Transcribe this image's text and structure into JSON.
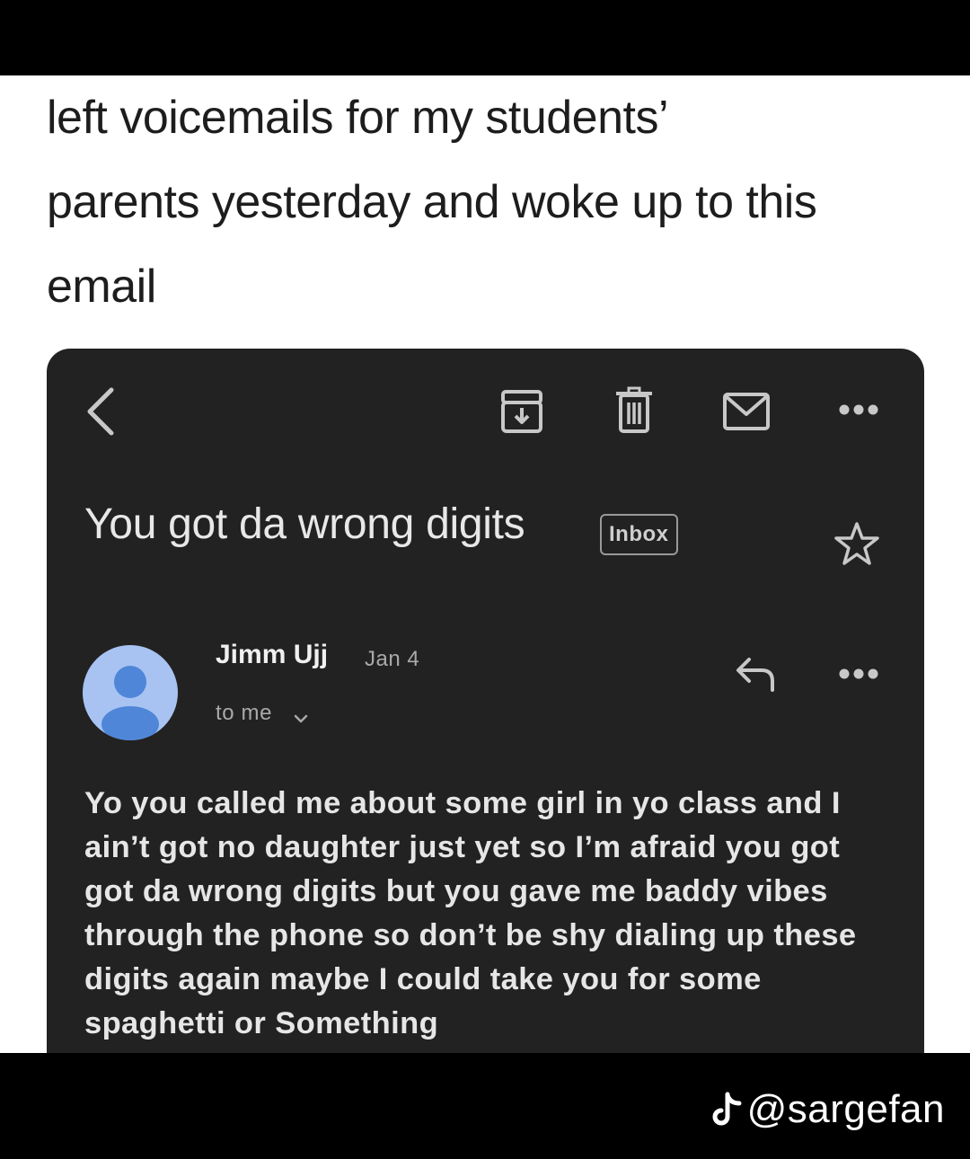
{
  "caption": {
    "line1": "left voicemails for my students’",
    "line2": "parents yesterday and woke up to this",
    "line3": "email"
  },
  "email": {
    "subject": "You got da wrong digits",
    "badge": "Inbox",
    "sender": "Jimm Ujj",
    "date": "Jan 4",
    "recipient": "to me",
    "body": "Yo you called me about some girl in yo class and I ain’t got no daughter just yet so I’m afraid you got got da wrong digits but you gave me baddy vibes through the phone so don’t be shy dialing up these digits again maybe I could take you for some spaghetti or Something"
  },
  "watermark": {
    "handle": "@sargefan"
  },
  "icons": [
    "back-icon",
    "archive-icon",
    "trash-icon",
    "mail-icon",
    "more-icon",
    "star-icon",
    "avatar-icon",
    "chevron-down-icon",
    "reply-icon",
    "tiktok-icon"
  ],
  "colors": {
    "card": "#222222",
    "avatar": "#a8c3f2",
    "avatar_person": "#4f86d8"
  }
}
